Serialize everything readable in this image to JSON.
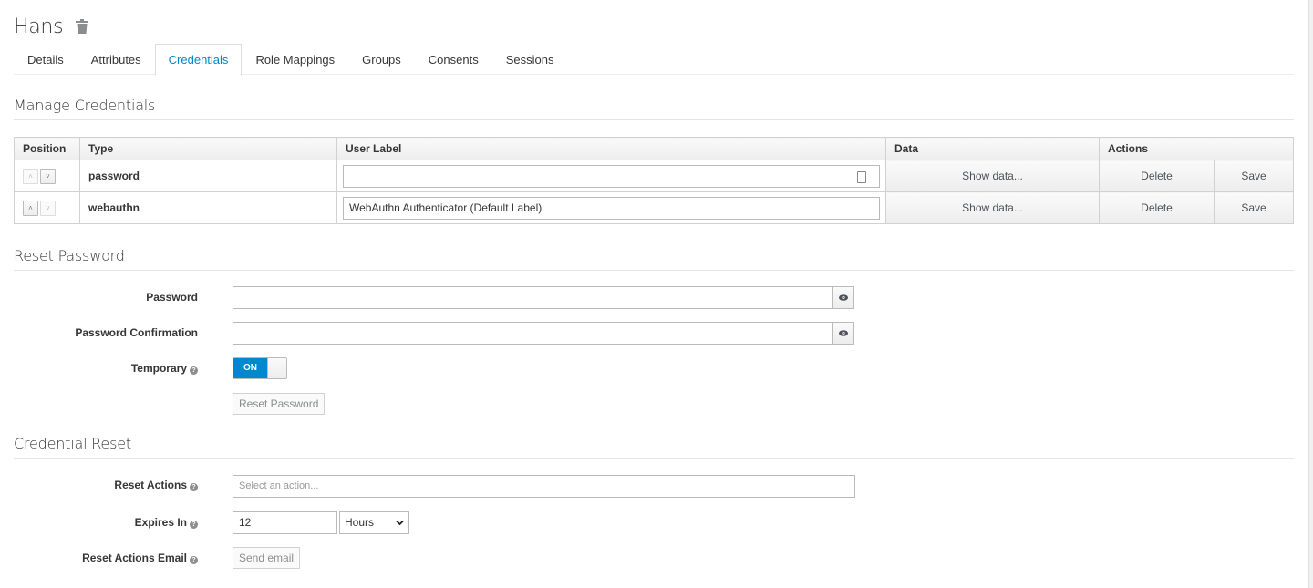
{
  "header": {
    "user_name": "Hans",
    "delete_icon": "trash-icon"
  },
  "tabs": [
    {
      "label": "Details",
      "active": false
    },
    {
      "label": "Attributes",
      "active": false
    },
    {
      "label": "Credentials",
      "active": true
    },
    {
      "label": "Role Mappings",
      "active": false
    },
    {
      "label": "Groups",
      "active": false
    },
    {
      "label": "Consents",
      "active": false
    },
    {
      "label": "Sessions",
      "active": false
    }
  ],
  "manage_credentials": {
    "title": "Manage Credentials",
    "columns": {
      "position": "Position",
      "type": "Type",
      "user_label": "User Label",
      "data": "Data",
      "actions": "Actions"
    },
    "rows": [
      {
        "type": "password",
        "user_label": "",
        "data_button": "Show data...",
        "delete_button": "Delete",
        "save_button": "Save",
        "move_up_enabled": false,
        "move_down_enabled": true
      },
      {
        "type": "webauthn",
        "user_label": "WebAuthn Authenticator (Default Label)",
        "data_button": "Show data...",
        "delete_button": "Delete",
        "save_button": "Save",
        "move_up_enabled": true,
        "move_down_enabled": false
      }
    ]
  },
  "reset_password": {
    "title": "Reset Password",
    "password_label": "Password",
    "password_value": "",
    "confirmation_label": "Password Confirmation",
    "confirmation_value": "",
    "temporary_label": "Temporary",
    "temporary_state": "ON",
    "reset_button": "Reset Password"
  },
  "credential_reset": {
    "title": "Credential Reset",
    "reset_actions_label": "Reset Actions",
    "reset_actions_placeholder": "Select an action...",
    "expires_label": "Expires In",
    "expires_value": "12",
    "expires_unit": "Hours",
    "email_label": "Reset Actions Email",
    "email_button": "Send email"
  },
  "colors": {
    "accent": "#0088ce",
    "text": "#363636",
    "border": "#d1d1d1"
  }
}
